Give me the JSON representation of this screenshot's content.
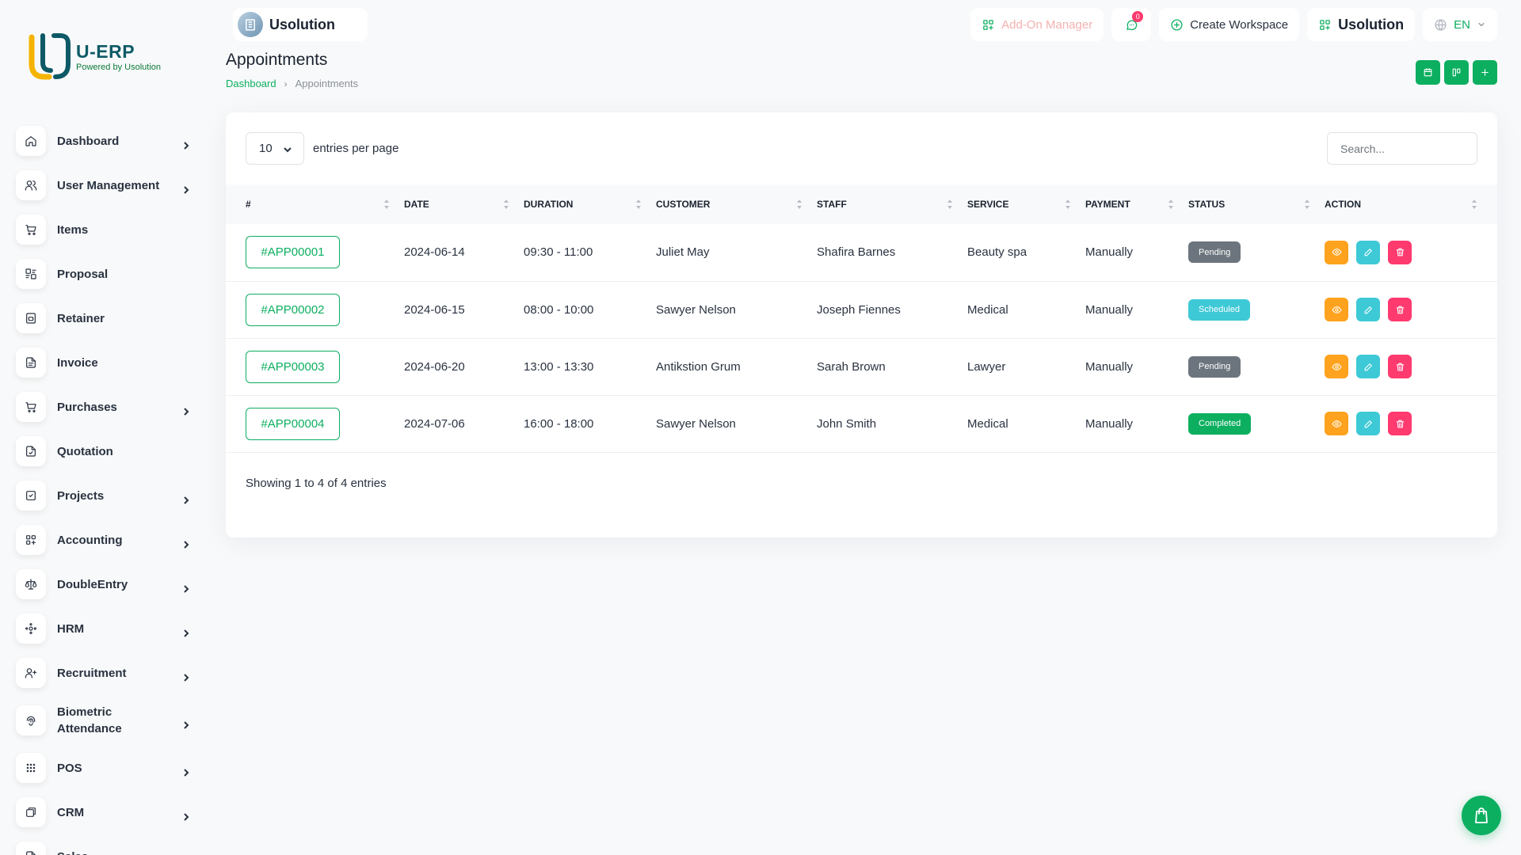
{
  "brand": {
    "name": "U-ERP",
    "tagline": "Powered by Usolution"
  },
  "sidebar": {
    "items": [
      {
        "label": "Dashboard",
        "icon": "home-icon",
        "submenu": true
      },
      {
        "label": "User Management",
        "icon": "users-icon",
        "submenu": true
      },
      {
        "label": "Items",
        "icon": "cart-icon",
        "submenu": false
      },
      {
        "label": "Proposal",
        "icon": "proposal-icon",
        "submenu": false
      },
      {
        "label": "Retainer",
        "icon": "file-icon",
        "submenu": false
      },
      {
        "label": "Invoice",
        "icon": "invoice-icon",
        "submenu": false
      },
      {
        "label": "Purchases",
        "icon": "cart-icon",
        "submenu": true
      },
      {
        "label": "Quotation",
        "icon": "document-icon",
        "submenu": false
      },
      {
        "label": "Projects",
        "icon": "checkbox-icon",
        "submenu": true
      },
      {
        "label": "Accounting",
        "icon": "layout-grid-icon",
        "submenu": true
      },
      {
        "label": "DoubleEntry",
        "icon": "scale-icon",
        "submenu": true
      },
      {
        "label": "HRM",
        "icon": "hrm-icon",
        "submenu": true
      },
      {
        "label": "Recruitment",
        "icon": "user-plus-icon",
        "submenu": true
      },
      {
        "label": "Biometric Attendance",
        "icon": "fingerprint-icon",
        "submenu": true
      },
      {
        "label": "POS",
        "icon": "dots-grid-icon",
        "submenu": true
      },
      {
        "label": "CRM",
        "icon": "crm-icon",
        "submenu": true
      },
      {
        "label": "Sales",
        "icon": "sales-icon",
        "submenu": true
      }
    ]
  },
  "header": {
    "workspace_name": "Usolution",
    "addon_label": "Add-On Manager",
    "notification_count": "0",
    "create_workspace_label": "Create Workspace",
    "company_label": "Usolution",
    "language": "EN"
  },
  "page": {
    "title": "Appointments",
    "breadcrumb": {
      "home": "Dashboard",
      "current": "Appointments"
    }
  },
  "table": {
    "per_page_value": "10",
    "per_page_label": "entries per page",
    "search_placeholder": "Search...",
    "columns": [
      "#",
      "DATE",
      "DURATION",
      "CUSTOMER",
      "STAFF",
      "SERVICE",
      "PAYMENT",
      "STATUS",
      "ACTION"
    ],
    "rows": [
      {
        "id": "#APP00001",
        "date": "2024-06-14",
        "duration": "09:30 - 11:00",
        "customer": "Juliet May",
        "staff": "Shafira Barnes",
        "service": "Beauty spa",
        "payment": "Manually",
        "status": "Pending"
      },
      {
        "id": "#APP00002",
        "date": "2024-06-15",
        "duration": "08:00 - 10:00",
        "customer": "Sawyer Nelson",
        "staff": "Joseph Fiennes",
        "service": "Medical",
        "payment": "Manually",
        "status": "Scheduled"
      },
      {
        "id": "#APP00003",
        "date": "2024-06-20",
        "duration": "13:00 - 13:30",
        "customer": "Antikstion Grum",
        "staff": "Sarah Brown",
        "service": "Lawyer",
        "payment": "Manually",
        "status": "Pending"
      },
      {
        "id": "#APP00004",
        "date": "2024-07-06",
        "duration": "16:00 - 18:00",
        "customer": "Sawyer Nelson",
        "staff": "John Smith",
        "service": "Medical",
        "payment": "Manually",
        "status": "Completed"
      }
    ],
    "footer": "Showing 1 to 4 of 4 entries"
  },
  "colors": {
    "primary": "#0caf60",
    "status_pending": "#6c757d",
    "status_scheduled": "#3ec9d6",
    "status_completed": "#0caf60",
    "action_view": "#ffa21d",
    "action_edit": "#3ec9d6",
    "action_delete": "#ff3a6e",
    "logo_yellow": "#f5b400",
    "logo_teal": "#0d5a66"
  }
}
